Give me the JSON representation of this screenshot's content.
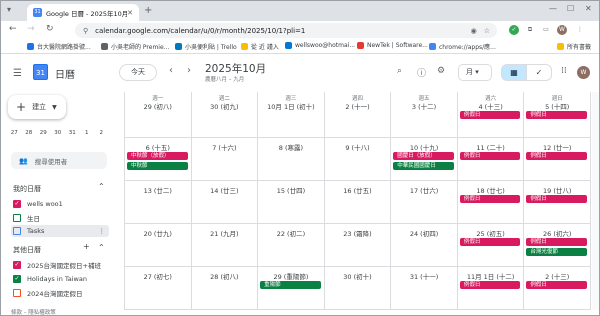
{
  "browser": {
    "tab_title": "Google 日曆 - 2025年10月",
    "tab_icon": "31",
    "url": "calendar.google.com/calendar/u/0/r/month/2025/10/1?pli=1",
    "bookmarks": [
      "台大醫院網路掛號...",
      "小吳老師的 Premie...",
      "小吳便利貼 | Trello",
      "從 近 謹入",
      "wellswoo@hotmai...",
      "NewTek | Software...",
      "chrome://apps/應...",
      "所有書籤"
    ],
    "avatar_letter": "W"
  },
  "header": {
    "brand": "日曆",
    "logo_day": "31",
    "today_label": "今天",
    "month_title": "2025年10月",
    "lunar_subtitle": "農曆八月 – 九月",
    "view_label": "月",
    "view_dd": "▾"
  },
  "sidebar": {
    "create_label": "建立",
    "mini_row": [
      "27",
      "28",
      "29",
      "30",
      "31",
      "1",
      "2"
    ],
    "search_users": "搜尋使用者",
    "my_calendars_title": "我的日曆",
    "my_calendars": [
      {
        "label": "wells woo1",
        "color": "#d81b60",
        "checked": true
      },
      {
        "label": "生日",
        "color": "#0b8043",
        "checked": false
      },
      {
        "label": "Tasks",
        "color": "#4285f4",
        "checked": false
      }
    ],
    "other_calendars_title": "其他日曆",
    "other_calendars": [
      {
        "label": "2025台灣國定假日+補班",
        "color": "#d81b60",
        "checked": true
      },
      {
        "label": "Holidays in Taiwan",
        "color": "#0b8043",
        "checked": true
      },
      {
        "label": "2024台灣國定假日",
        "color": "#f4511e",
        "checked": false
      }
    ],
    "footer": "條款 – 隱私權政策"
  },
  "weekdays": [
    "週一",
    "週二",
    "週三",
    "週四",
    "週五",
    "週六",
    "週日"
  ],
  "weeks": [
    [
      {
        "label": "29 (初八)",
        "events": []
      },
      {
        "label": "30 (初九)",
        "events": []
      },
      {
        "label": "10月 1日 (初十)",
        "events": []
      },
      {
        "label": "2 (十一)",
        "events": []
      },
      {
        "label": "3 (十二)",
        "events": []
      },
      {
        "label": "4 (十三)",
        "events": [
          {
            "text": "例假日",
            "color": "red"
          }
        ]
      },
      {
        "label": "5 (十四)",
        "events": [
          {
            "text": "例假日",
            "color": "red"
          }
        ]
      }
    ],
    [
      {
        "label": "6 (十五)",
        "events": [
          {
            "text": "中秋節（放假）",
            "color": "red"
          },
          {
            "text": "中秋節",
            "color": "green"
          }
        ]
      },
      {
        "label": "7 (十六)",
        "events": []
      },
      {
        "label": "8 (寒露)",
        "events": []
      },
      {
        "label": "9 (十八)",
        "events": []
      },
      {
        "label": "10 (十九)",
        "events": [
          {
            "text": "國慶日（放假）",
            "color": "red"
          },
          {
            "text": "中華民國國慶日",
            "color": "green"
          }
        ]
      },
      {
        "label": "11 (二十)",
        "events": [
          {
            "text": "例假日",
            "color": "red"
          }
        ]
      },
      {
        "label": "12 (廿一)",
        "events": [
          {
            "text": "例假日",
            "color": "red"
          }
        ]
      }
    ],
    [
      {
        "label": "13 (廿二)",
        "events": []
      },
      {
        "label": "14 (廿三)",
        "events": []
      },
      {
        "label": "15 (廿四)",
        "events": []
      },
      {
        "label": "16 (廿五)",
        "events": []
      },
      {
        "label": "17 (廿六)",
        "events": []
      },
      {
        "label": "18 (廿七)",
        "events": [
          {
            "text": "例假日",
            "color": "red"
          }
        ]
      },
      {
        "label": "19 (廿八)",
        "events": [
          {
            "text": "例假日",
            "color": "red"
          }
        ]
      }
    ],
    [
      {
        "label": "20 (廿九)",
        "events": []
      },
      {
        "label": "21 (九月)",
        "events": []
      },
      {
        "label": "22 (初二)",
        "events": []
      },
      {
        "label": "23 (霜降)",
        "events": []
      },
      {
        "label": "24 (初四)",
        "events": []
      },
      {
        "label": "25 (初五)",
        "events": [
          {
            "text": "例假日",
            "color": "red"
          }
        ]
      },
      {
        "label": "26 (初六)",
        "events": [
          {
            "text": "例假日",
            "color": "red"
          },
          {
            "text": "台灣光復節",
            "color": "green"
          }
        ]
      }
    ],
    [
      {
        "label": "27 (初七)",
        "events": []
      },
      {
        "label": "28 (初八)",
        "events": []
      },
      {
        "label": "29 (重陽節)",
        "events": [
          {
            "text": "重陽節",
            "color": "green"
          }
        ]
      },
      {
        "label": "30 (初十)",
        "events": []
      },
      {
        "label": "31 (十一)",
        "events": []
      },
      {
        "label": "11月 1日 (十二)",
        "events": [
          {
            "text": "例假日",
            "color": "red"
          }
        ]
      },
      {
        "label": "2 (十三)",
        "events": [
          {
            "text": "例假日",
            "color": "red"
          }
        ]
      }
    ]
  ]
}
